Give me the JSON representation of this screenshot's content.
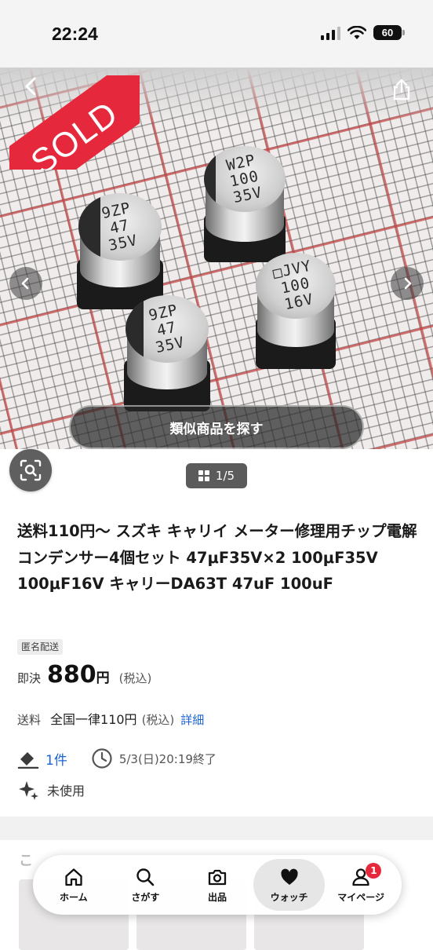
{
  "status_bar": {
    "time": "22:24",
    "battery": "60"
  },
  "photo": {
    "sold_label": "SOLD",
    "capacitors": [
      {
        "marking": "9ZP\n47\n35V"
      },
      {
        "marking": "W2P\n100\n35V"
      },
      {
        "marking": "□JVY\n100\n16V"
      },
      {
        "marking": "9ZP\n47\n35V"
      }
    ],
    "similar_button": "類似商品を探す"
  },
  "image_counter": "1/5",
  "product": {
    "title": "送料110円〜 スズキ キャリイ メーター修理用チップ電解コンデンサー4個セット 47μF35V×2 100μF35V 100μF16V キャリーDA63T 47uF 100uF",
    "tag": "匿名配送",
    "price_label": "即決",
    "price": "880",
    "price_unit": "円",
    "price_tax": "(税込)",
    "shipping_label": "送料",
    "shipping_value": "全国一律110円",
    "shipping_tax": "(税込)",
    "shipping_detail": "詳細",
    "bids": "1件",
    "end_time": "5/3(日)20:19終了",
    "condition": "未使用"
  },
  "next_section": {
    "title": "こ"
  },
  "tabbar": {
    "items": [
      {
        "label": "ホーム",
        "icon": "home-icon"
      },
      {
        "label": "さがす",
        "icon": "search-icon"
      },
      {
        "label": "出品",
        "icon": "camera-icon"
      },
      {
        "label": "ウォッチ",
        "icon": "heart-icon"
      },
      {
        "label": "マイページ",
        "icon": "user-icon",
        "badge": "1"
      }
    ]
  },
  "colors": {
    "sold_red": "#e5283b",
    "link_blue": "#1b63d6"
  }
}
